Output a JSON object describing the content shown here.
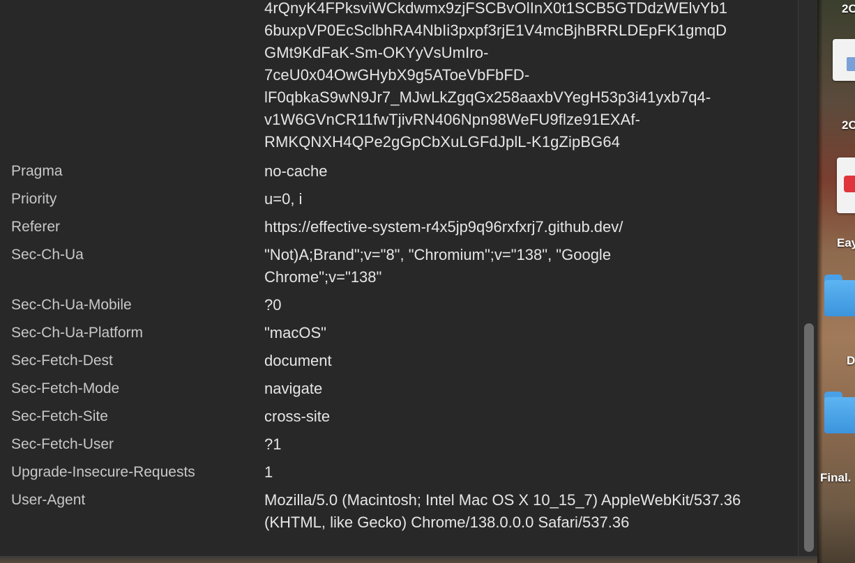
{
  "headers": {
    "cookie_value_lines": [
      "4rQnyK4FPksviWCkdwmx9zjFSCBvOlInX0t1SCB5GTDdzWElvYb1",
      "6buxpVP0EcSclbhRA4NbIi3pxpf3rjE1V4mcBjhBRRLDEpFK1gmqD",
      "GMt9KdFaK-Sm-OKYyVsUmIro-",
      "7ceU0x04OwGHybX9g5AToeVbFbFD-",
      "lF0qbkaS9wN9Jr7_MJwLkZgqGx258aaxbVYegH53p3i41yxb7q4-",
      "v1W6GVnCR11fwTjivRN406Npn98WeFU9flze91EXAf-",
      "RMKQNXH4QPe2gGpCbXuLGFdJplL-K1gZipBG64"
    ],
    "rows": [
      {
        "name": "Pragma",
        "value": "no-cache"
      },
      {
        "name": "Priority",
        "value": "u=0, i"
      },
      {
        "name": "Referer",
        "value": "https://effective-system-r4x5jp9q96rxfxrj7.github.dev/"
      },
      {
        "name": "Sec-Ch-Ua",
        "value": "\"Not)A;Brand\";v=\"8\", \"Chromium\";v=\"138\", \"Google Chrome\";v=\"138\""
      },
      {
        "name": "Sec-Ch-Ua-Mobile",
        "value": "?0"
      },
      {
        "name": "Sec-Ch-Ua-Platform",
        "value": "\"macOS\""
      },
      {
        "name": "Sec-Fetch-Dest",
        "value": "document"
      },
      {
        "name": "Sec-Fetch-Mode",
        "value": "navigate"
      },
      {
        "name": "Sec-Fetch-Site",
        "value": "cross-site"
      },
      {
        "name": "Sec-Fetch-User",
        "value": "?1"
      },
      {
        "name": "Upgrade-Insecure-Requests",
        "value": "1"
      },
      {
        "name": "User-Agent",
        "value": "Mozilla/5.0 (Macintosh; Intel Mac OS X 10_15_7) AppleWebKit/537.36 (KHTML, like Gecko) Chrome/138.0.0.0 Safari/537.36"
      }
    ]
  },
  "desktop": {
    "labels": [
      "2C",
      "2C",
      "Eay",
      "D",
      "Final."
    ]
  }
}
